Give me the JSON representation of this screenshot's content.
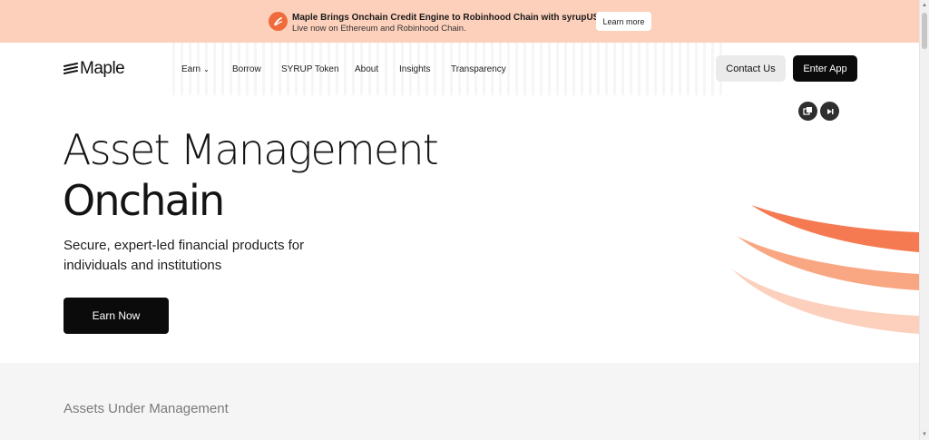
{
  "banner": {
    "title": "Maple Brings Onchain Credit Engine to Robinhood Chain with syrupUSDG",
    "subtitle": "Live now on Ethereum and Robinhood Chain.",
    "button_label": "Learn more",
    "icon": "maple-circle-icon",
    "color": "#fdd0bb",
    "accent": "#f06a3c"
  },
  "nav": {
    "logo_text": "Maple",
    "items": [
      {
        "label": "Earn",
        "has_dropdown": true
      },
      {
        "label": "Borrow"
      },
      {
        "label": "SYRUP Token"
      },
      {
        "label": "About"
      },
      {
        "label": "Insights"
      },
      {
        "label": "Transparency"
      }
    ],
    "contact_label": "Contact Us",
    "enter_label": "Enter App"
  },
  "media_controls": {
    "icons": [
      "picture-in-picture-icon",
      "skip-forward-icon"
    ]
  },
  "hero": {
    "title_line1": "Asset Management",
    "title_line2": "Onchain",
    "subtitle": "Secure, expert-led financial products for individuals and institutions",
    "cta_label": "Earn Now"
  },
  "stats": {
    "label": "Assets Under Management"
  },
  "colors": {
    "swoosh_1": "#f57a52",
    "swoosh_2": "#f9a782",
    "swoosh_3": "#fcd0bd",
    "dark": "#0b0b0b"
  }
}
